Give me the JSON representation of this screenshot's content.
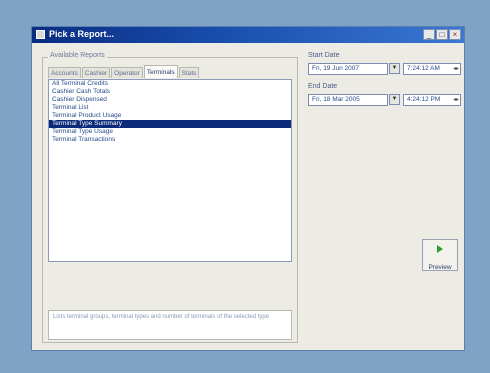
{
  "window": {
    "title": "Pick a Report...",
    "buttons": {
      "minimize": "_",
      "maximize": "□",
      "close": "×"
    }
  },
  "reports": {
    "group_label": "Available Reports",
    "tabs": [
      {
        "label": "Accounts"
      },
      {
        "label": "Cashier"
      },
      {
        "label": "Operator"
      },
      {
        "label": "Terminals"
      },
      {
        "label": "Stats"
      }
    ],
    "active_tab": "Terminals",
    "items": [
      {
        "label": "All Terminal Credits"
      },
      {
        "label": "Cashier Cash Totals"
      },
      {
        "label": "Cashier Dispensed"
      },
      {
        "label": "Terminal List"
      },
      {
        "label": "Terminal Product Usage"
      },
      {
        "label": "Terminal Type Summary"
      },
      {
        "label": "Terminal Type Usage"
      },
      {
        "label": "Terminal Transactions"
      }
    ],
    "selected_item": "Terminal Type Summary",
    "description": "Lists terminal groups, terminal types and number of terminals of the selected type"
  },
  "start_date": {
    "label": "Start Date",
    "date": "Fri, 19 Jun 2007",
    "time": "7:24:12 AM"
  },
  "end_date": {
    "label": "End Date",
    "date": "Fri, 18 Mar 2005",
    "time": "4:24:12 PM"
  },
  "preview_button": {
    "label": "Preview"
  },
  "icons": {
    "app": "window-icon",
    "dropdown": "chevron-down-icon",
    "spin": "spin-arrows-icon",
    "preview": "play-arrow-icon"
  },
  "colors": {
    "desktop": "#7fa3c4",
    "titlebar": "#0a2c82",
    "selection": "#0b2a7a",
    "preview_icon": "#2f9c2f"
  }
}
